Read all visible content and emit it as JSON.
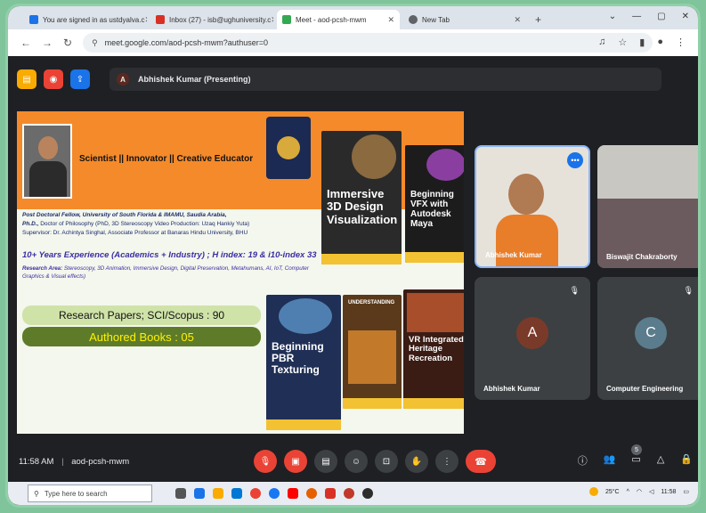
{
  "browser": {
    "tabs": [
      {
        "label": "You are signed in as ustdyalva.c",
        "active": false
      },
      {
        "label": "Inbox (27) - isb@ughuniversity.c",
        "active": false
      },
      {
        "label": "Meet - aod-pcsh-mwm",
        "active": true
      },
      {
        "label": "New Tab",
        "active": false
      }
    ],
    "url": "meet.google.com/aod-pcsh-mwm?authuser=0"
  },
  "meet": {
    "presenter_initial": "A",
    "presenter_label": "Abhishek Kumar (Presenting)",
    "time": "11:58 AM",
    "separator": "|",
    "meeting_code": "aod-pcsh-mwm",
    "people_count": "5"
  },
  "slide": {
    "tagline": "Scientist || Innovator || Creative Educator",
    "bio_line1_bold": "Post Doctoral Fellow, University of South Florida & IMAMU, Saudia Arabia,",
    "bio_line2_bold": "Ph.D.,",
    "bio_line2": " Doctor of Philosophy (PhD, 3D Stereoscopy Video Production: Uzaq Hankiy Yuta)",
    "bio_line3": "Supervisor: Dr. Achintya Singhal, Associate Professor at Banaras Hindu University, BHU",
    "experience": "10+ Years Experience (Academics + Industry) ; H index: 19 & i10-index 33",
    "research_label": "Research Area:",
    "research": " Stereoscopy, 3D Animation, Immersive Design, Digital Preservation, Metahumans, AI, IoT, Computer Graphics & Visual effects)",
    "papers": "Research Papers; SCI/Scopus : 90",
    "books_count": "Authored Books : 05",
    "books": [
      {
        "title": "Immersive 3D Design Visualization"
      },
      {
        "title": "Beginning VFX with Autodesk Maya"
      },
      {
        "title": "Beginning PBR Texturing"
      },
      {
        "title": "UNDERSTANDING"
      },
      {
        "title": "VR Integrated Heritage Recreation"
      }
    ]
  },
  "participants": [
    {
      "name": "Abhishek Kumar",
      "initial": ""
    },
    {
      "name": "Biswajit Chakraborty",
      "initial": ""
    },
    {
      "name": "Abhishek Kumar",
      "initial": "A"
    },
    {
      "name": "Computer Engineering",
      "initial": "C"
    }
  ],
  "taskbar": {
    "search_placeholder": "Type here to search",
    "temp": "25°C",
    "clock": "11:58"
  },
  "colors": {
    "slide_orange": "#f58a2a",
    "hangup_red": "#ea4335",
    "avatar_a": "#7a3a2a",
    "avatar_c": "#5b7c8c"
  }
}
